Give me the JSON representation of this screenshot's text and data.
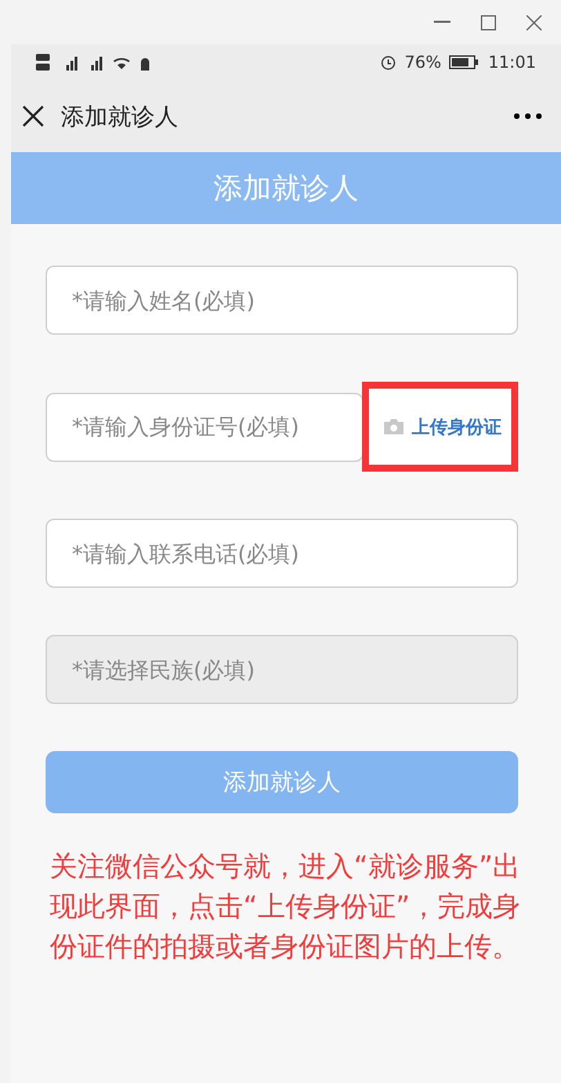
{
  "status_bar": {
    "battery": "76%",
    "time": "11:01"
  },
  "nav": {
    "title": "添加就诊人"
  },
  "header": {
    "title": "添加就诊人"
  },
  "fields": [
    {
      "kind": "input",
      "placeholder": "*请输入姓名(必填)"
    },
    {
      "kind": "id",
      "placeholder": "*请输入身份证号(必填)",
      "upload": {
        "label": "上传身份证",
        "highlighted": true
      }
    },
    {
      "kind": "input",
      "placeholder": "*请输入联系电话(必填)"
    },
    {
      "kind": "select",
      "placeholder": "*请选择民族(必填)"
    }
  ],
  "submit": "添加就诊人",
  "note": "关注微信公众号就，进入“就诊服务”出现此界面，点击“上传身份证”，完成身份证件的拍摄或者身份证图片的上传。"
}
